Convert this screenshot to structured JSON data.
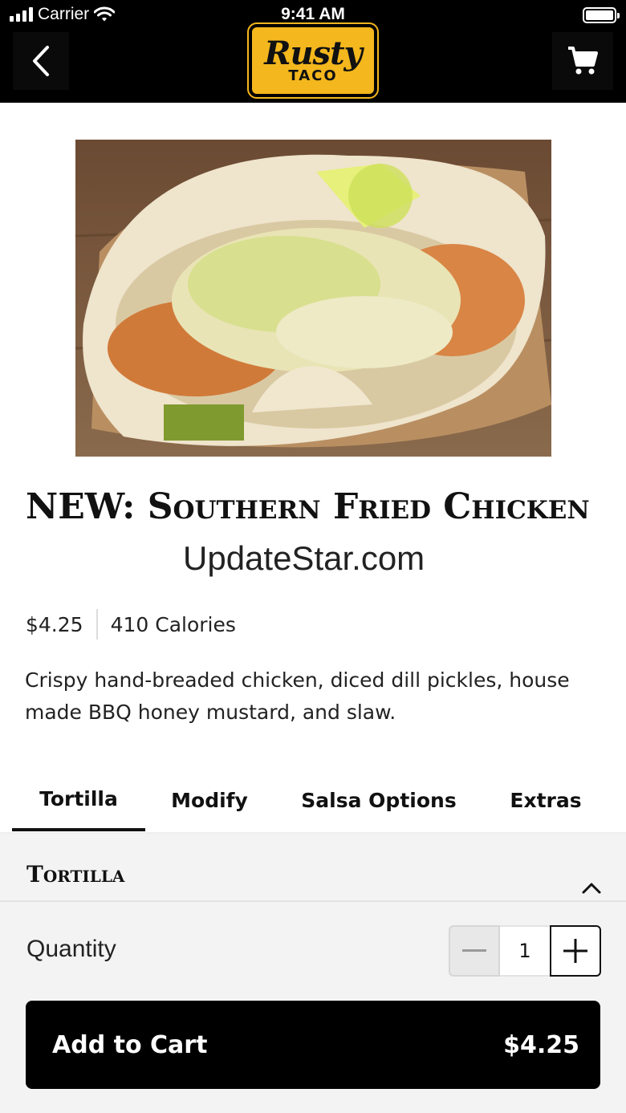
{
  "status_bar": {
    "carrier": "Carrier",
    "time": "9:41 AM"
  },
  "header": {
    "logo_line1": "Rusty",
    "logo_line2": "TACO",
    "back_icon": "chevron-left-icon",
    "cart_icon": "cart-icon"
  },
  "item": {
    "title": "NEW: Southern Fried Chicken",
    "watermark": "UpdateStar.com",
    "price": "$4.25",
    "calories": "410 Calories",
    "description": "Crispy hand-breaded chicken, diced dill pickles, house made BBQ honey mustard, and slaw."
  },
  "tabs": [
    {
      "label": "Tortilla"
    },
    {
      "label": "Modify"
    },
    {
      "label": "Salsa Options"
    },
    {
      "label": "Extras"
    }
  ],
  "section": {
    "heading": "Tortilla",
    "toggle_icon": "chevron-up-icon"
  },
  "quantity": {
    "label": "Quantity",
    "value": "1",
    "minus_icon": "minus-icon",
    "plus_icon": "plus-icon"
  },
  "cart_button": {
    "label": "Add to Cart",
    "price": "$4.25"
  },
  "colors": {
    "brand_yellow": "#f4b71d",
    "header_bg": "#000000",
    "button_bg": "#000000"
  }
}
